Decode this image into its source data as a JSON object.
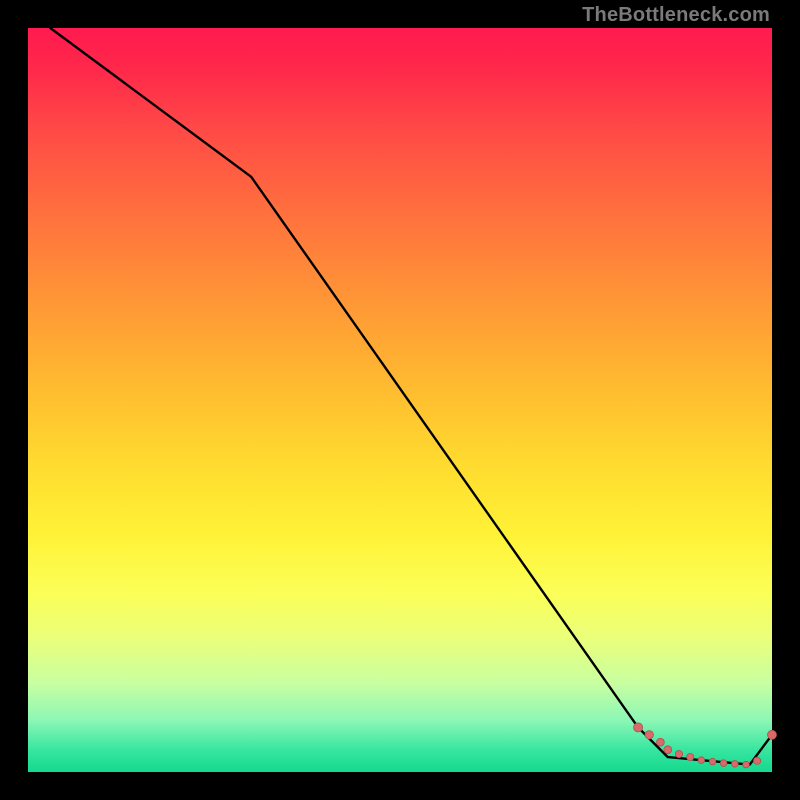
{
  "attribution": "TheBottleneck.com",
  "colors": {
    "line": "#000000",
    "marker_fill": "#d96a6a",
    "marker_stroke": "#b14d4d"
  },
  "chart_data": {
    "type": "line",
    "title": "",
    "xlabel": "",
    "ylabel": "",
    "xlim": [
      0,
      100
    ],
    "ylim": [
      0,
      100
    ],
    "series": [
      {
        "name": "curve",
        "x": [
          3,
          30,
          82,
          86,
          97,
          100
        ],
        "y": [
          100,
          80,
          6,
          2,
          1,
          5
        ]
      }
    ],
    "markers": {
      "name": "dots",
      "x": [
        82,
        83.5,
        85,
        86,
        87.5,
        89,
        90.5,
        92,
        93.5,
        95,
        96.5,
        98,
        100
      ],
      "y": [
        6,
        5,
        4,
        3,
        2.4,
        2,
        1.6,
        1.4,
        1.2,
        1.1,
        1,
        1.5,
        5
      ],
      "r": [
        4.5,
        4.2,
        3.9,
        3.9,
        3.6,
        3.6,
        3.3,
        3.3,
        3.3,
        3.3,
        3.3,
        3.6,
        4.5
      ]
    }
  }
}
